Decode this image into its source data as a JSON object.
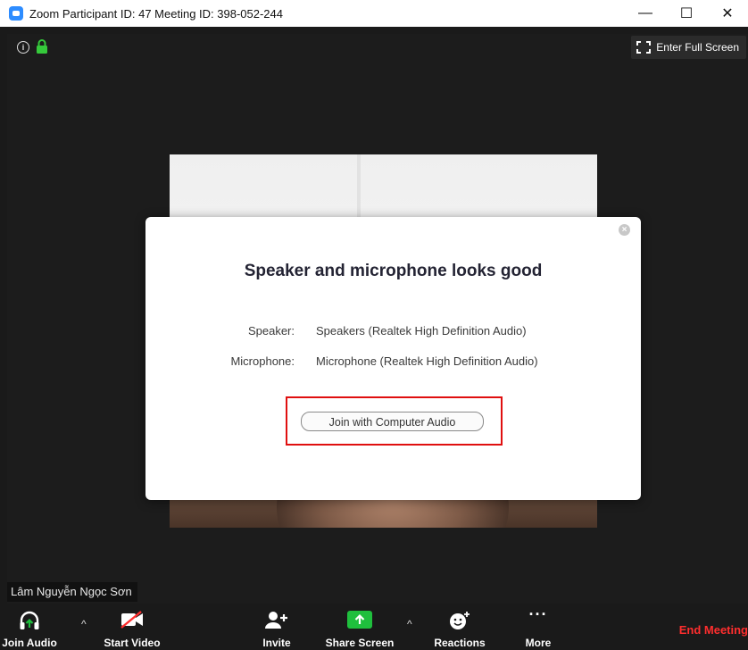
{
  "window": {
    "title": "Zoom Participant ID: 47   Meeting ID: 398-052-244",
    "controls": {
      "minimize": "—",
      "maximize": "☐",
      "close": "✕"
    }
  },
  "meeting": {
    "fullscreen_label": "Enter Full Screen",
    "participant_name": "Lâm Nguyễn Ngọc Sơn"
  },
  "dialog": {
    "title": "Speaker and microphone looks good",
    "speaker_label": "Speaker:",
    "speaker_value": "Speakers (Realtek High Definition Audio)",
    "microphone_label": "Microphone:",
    "microphone_value": "Microphone (Realtek High Definition Audio)",
    "join_button": "Join with Computer Audio",
    "close_glyph": "×"
  },
  "toolbar": {
    "join_audio": "Join Audio",
    "start_video": "Start Video",
    "invite": "Invite",
    "share_screen": "Share Screen",
    "reactions": "Reactions",
    "more": "More",
    "end_meeting": "End Meeting",
    "caret": "^",
    "more_glyph": "···"
  },
  "colors": {
    "zoom_blue": "#2d8cff",
    "share_green": "#1fbf3d",
    "end_red": "#ff2e2e",
    "highlight_red": "#e01010"
  }
}
